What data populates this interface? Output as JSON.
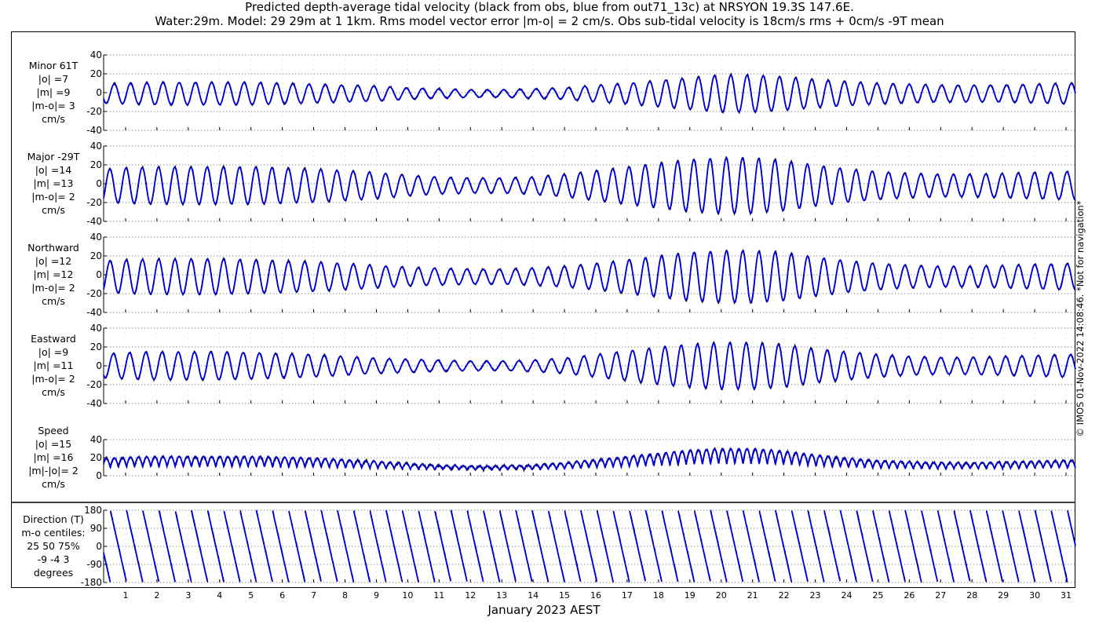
{
  "title": {
    "line1": "Predicted depth-average tidal velocity (black from obs, blue from out71_13c) at NRSYON 19.3S 147.6E.",
    "line2": "Water:29m. Model: 29 29m at 1 1km. Rms model vector error |m-o| = 2 cm/s. Obs sub-tidal velocity is 18cm/s rms + 0cm/s -9T mean"
  },
  "footer": "© IMOS 01-Nov-2022 14:08:46. *Not for navigation*",
  "colors": {
    "obs": "#000000",
    "model": "#0000dd",
    "grid": "#555555"
  },
  "chart_data": {
    "type": "line",
    "xlabel": "January 2023 AEST",
    "x_ticks": [
      "1",
      "2",
      "3",
      "4",
      "5",
      "6",
      "7",
      "8",
      "9",
      "10",
      "11",
      "12",
      "13",
      "14",
      "15",
      "16",
      "17",
      "18",
      "19",
      "20",
      "21",
      "22",
      "23",
      "24",
      "25",
      "26",
      "27",
      "28",
      "29",
      "30",
      "31"
    ],
    "xlim": [
      0.3,
      31.3
    ],
    "series_names": [
      "obs",
      "out71_13c"
    ],
    "panels": [
      {
        "key": "minor",
        "label": [
          "Minor 61T",
          "|o| =7",
          "|m| =9",
          "|m-o|= 3",
          "cm/s"
        ],
        "ylim": [
          -40,
          40
        ],
        "yticks": [
          "40",
          "20",
          "0",
          "-20",
          "-40"
        ],
        "kind": "velocity",
        "amplitude_by_day": [
          10,
          11,
          12,
          12,
          12,
          12,
          11,
          10,
          9,
          8,
          6,
          5,
          4,
          4,
          5,
          6,
          9,
          11,
          14,
          17,
          20,
          20,
          18,
          15,
          13,
          11,
          10,
          9,
          9,
          9,
          10,
          11
        ],
        "phase_deg": 0,
        "mean": -1
      },
      {
        "key": "major",
        "label": [
          "Major -29T",
          "|o| =14",
          "|m| =13",
          "|m-o|= 2",
          "cm/s"
        ],
        "ylim": [
          -40,
          40
        ],
        "yticks": [
          "40",
          "20",
          "0",
          "-20",
          "-40"
        ],
        "kind": "velocity",
        "amplitude_by_day": [
          17,
          19,
          20,
          20,
          20,
          20,
          19,
          18,
          16,
          14,
          11,
          9,
          8,
          8,
          9,
          12,
          16,
          20,
          24,
          28,
          30,
          30,
          27,
          22,
          18,
          15,
          13,
          12,
          12,
          13,
          14,
          15
        ],
        "phase_deg": 100,
        "mean": -2
      },
      {
        "key": "northward",
        "label": [
          "Northward",
          "|o| =12",
          "|m| =12",
          "|m-o|= 2",
          "cm/s"
        ],
        "ylim": [
          -40,
          40
        ],
        "yticks": [
          "40",
          "20",
          "0",
          "-20",
          "-40"
        ],
        "kind": "velocity",
        "amplitude_by_day": [
          16,
          18,
          19,
          19,
          19,
          18,
          17,
          16,
          14,
          12,
          10,
          9,
          8,
          8,
          9,
          11,
          14,
          18,
          22,
          26,
          28,
          28,
          26,
          21,
          17,
          14,
          12,
          11,
          11,
          12,
          13,
          14
        ],
        "phase_deg": 95,
        "mean": -2
      },
      {
        "key": "eastward",
        "label": [
          "Eastward",
          "|o| =9",
          "|m| =11",
          "|m-o|= 2",
          "cm/s"
        ],
        "ylim": [
          -40,
          40
        ],
        "yticks": [
          "40",
          "20",
          "0",
          "-20",
          "-40"
        ],
        "kind": "velocity",
        "amplitude_by_day": [
          12,
          14,
          15,
          15,
          15,
          14,
          13,
          12,
          10,
          8,
          7,
          6,
          5,
          5,
          6,
          8,
          12,
          16,
          20,
          23,
          25,
          25,
          23,
          18,
          15,
          12,
          10,
          9,
          9,
          10,
          11,
          12
        ],
        "phase_deg": 20,
        "mean": 0
      },
      {
        "key": "speed",
        "label": [
          "Speed",
          "|o| =15",
          "|m| =16",
          "|m|-|o|= 2",
          "cm/s"
        ],
        "ylim": [
          0,
          40
        ],
        "yticks": [
          "40",
          "20",
          "0"
        ],
        "kind": "speed",
        "amplitude_by_day": [
          17,
          19,
          20,
          20,
          20,
          20,
          19,
          18,
          16,
          14,
          11,
          9,
          8,
          8,
          9,
          12,
          16,
          20,
          24,
          28,
          30,
          30,
          27,
          22,
          18,
          15,
          13,
          12,
          12,
          13,
          14,
          15
        ],
        "phase_deg": 0,
        "mean": 0
      },
      {
        "key": "direction",
        "label": [
          "Direction (T)",
          "m-o centiles:",
          "25  50  75%",
          "-9 -4  3",
          "degrees"
        ],
        "ylim": [
          -180,
          180
        ],
        "yticks": [
          "180",
          "90",
          "0",
          "-90",
          "-180"
        ],
        "kind": "direction",
        "amplitude_by_day": [],
        "phase_deg": 0,
        "mean": 0
      }
    ]
  }
}
